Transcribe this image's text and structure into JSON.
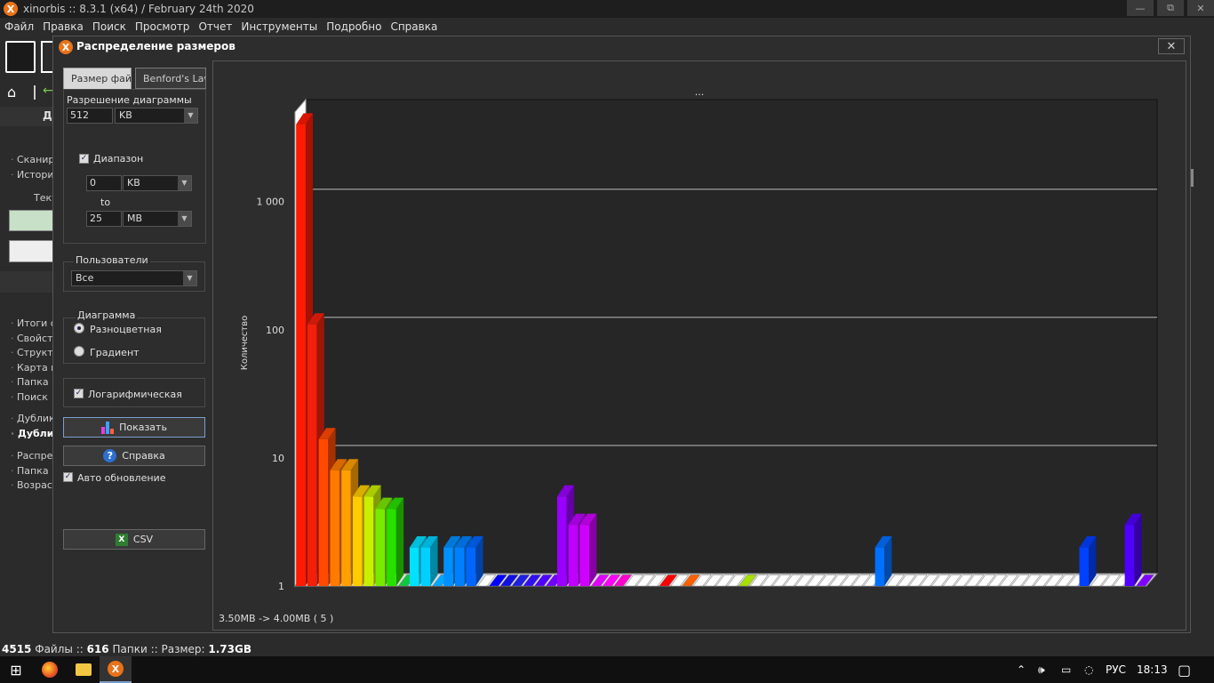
{
  "app": {
    "title": "xinorbis :: 8.3.1 (x64) / February 24th 2020",
    "logo_letter": "X",
    "controls": {
      "minimize": "—",
      "restore": "⧉",
      "close": "✕"
    }
  },
  "menu": [
    "Файл",
    "Правка",
    "Поиск",
    "Просмотр",
    "Отчет",
    "Инструменты",
    "Подробно",
    "Справка"
  ],
  "left_panel": {
    "header": "Д",
    "current_label": "Теку",
    "list1": [
      "Сканир",
      "Историз"
    ],
    "list2": [
      "Итоги с",
      "Свойств",
      "Структу",
      "Карта п",
      "Папка (",
      "Поиск"
    ],
    "list3": [
      "Дублик",
      "Дублик"
    ],
    "list4": [
      "Распред",
      "Папка (",
      "Возраст"
    ]
  },
  "dialog": {
    "title": "Распределение размеров",
    "close": "✕",
    "tabs": {
      "active": "Размер файла",
      "inactive": "Benford's Law"
    },
    "resolution": {
      "label": "Разрешение диаграммы",
      "value": "512",
      "unit": "KB"
    },
    "range": {
      "label": "Диапазон",
      "checked": true,
      "from_value": "0",
      "from_unit": "KB",
      "to_label": "to",
      "to_value": "25",
      "to_unit": "MB"
    },
    "users": {
      "label": "Пользователи",
      "value": "Все"
    },
    "diagram": {
      "label": "Диаграмма",
      "option1": "Разноцветная",
      "option2": "Градиент",
      "selected": "Разноцветная"
    },
    "log": {
      "label": "Логарифмическая",
      "checked": true
    },
    "buttons": {
      "show": "Показать",
      "help": "Справка",
      "help_icon": "?",
      "csv": "CSV",
      "csv_icon": "X"
    },
    "auto_update": {
      "label": "Авто обновление",
      "checked": true
    }
  },
  "chart_data": {
    "type": "bar",
    "title": "...",
    "ylabel": "Количество",
    "xlabel": "",
    "yscale": "log",
    "ylim": [
      1,
      5000
    ],
    "yticks": [
      "1",
      "10",
      "100",
      "1 000"
    ],
    "footer": "3.50MB -> 4.00MB ( 5 )",
    "values": [
      4000,
      110,
      14,
      8,
      8,
      5,
      5,
      4,
      4,
      1,
      2,
      2,
      1,
      2,
      2,
      2,
      1,
      1,
      1,
      1,
      1,
      1,
      1,
      5,
      3,
      3,
      1,
      1,
      1,
      1,
      1,
      1,
      1,
      1,
      1,
      1,
      1,
      1,
      1,
      1,
      1,
      1,
      1,
      1,
      1,
      1,
      1,
      1,
      1,
      1,
      1,
      2,
      1,
      1,
      1,
      1,
      1,
      1,
      1,
      1,
      1,
      1,
      1,
      1,
      1,
      1,
      1,
      1,
      1,
      2,
      1,
      1,
      1,
      3,
      1
    ],
    "colors": [
      "#ff1a00",
      "#f2200a",
      "#ff4a00",
      "#ff7a00",
      "#ffa000",
      "#ffcc00",
      "#c8f000",
      "#78ea00",
      "#28e000",
      "#10c840",
      "#00e0ff",
      "#00d0ff",
      "#00a8ff",
      "#0090ff",
      "#0080ff",
      "#0066ff",
      "#ffffff",
      "#0000ff",
      "#1010e0",
      "#2020e0",
      "#3010f0",
      "#5000ff",
      "#7000ff",
      "#9a00ff",
      "#c000ff",
      "#d000ff",
      "#e000ff",
      "#ff00ff",
      "#ff00d0",
      "#ffffff",
      "#ffffff",
      "#ffffff",
      "#ff0000",
      "#ffffff",
      "#ff6000",
      "#ffffff",
      "#ffffff",
      "#ffffff",
      "#ffffff",
      "#a8e000",
      "#ffffff",
      "#ffffff",
      "#ffffff",
      "#ffffff",
      "#ffffff",
      "#ffffff",
      "#ffffff",
      "#ffffff",
      "#ffffff",
      "#ffffff",
      "#ffffff",
      "#0070ff",
      "#ffffff",
      "#ffffff",
      "#ffffff",
      "#ffffff",
      "#ffffff",
      "#ffffff",
      "#ffffff",
      "#ffffff",
      "#ffffff",
      "#ffffff",
      "#ffffff",
      "#ffffff",
      "#ffffff",
      "#ffffff",
      "#ffffff",
      "#ffffff",
      "#ffffff",
      "#0040ff",
      "#ffffff",
      "#ffffff",
      "#ffffff",
      "#5000ff",
      "#8000ff"
    ]
  },
  "statusbar": {
    "files": "4515",
    "files_label": "Файлы",
    "folders": "616",
    "folders_label": "Папки",
    "size_label": "Размер:",
    "size": "1.73GB"
  },
  "taskbar": {
    "lang": "РУС",
    "time": "18:13"
  }
}
